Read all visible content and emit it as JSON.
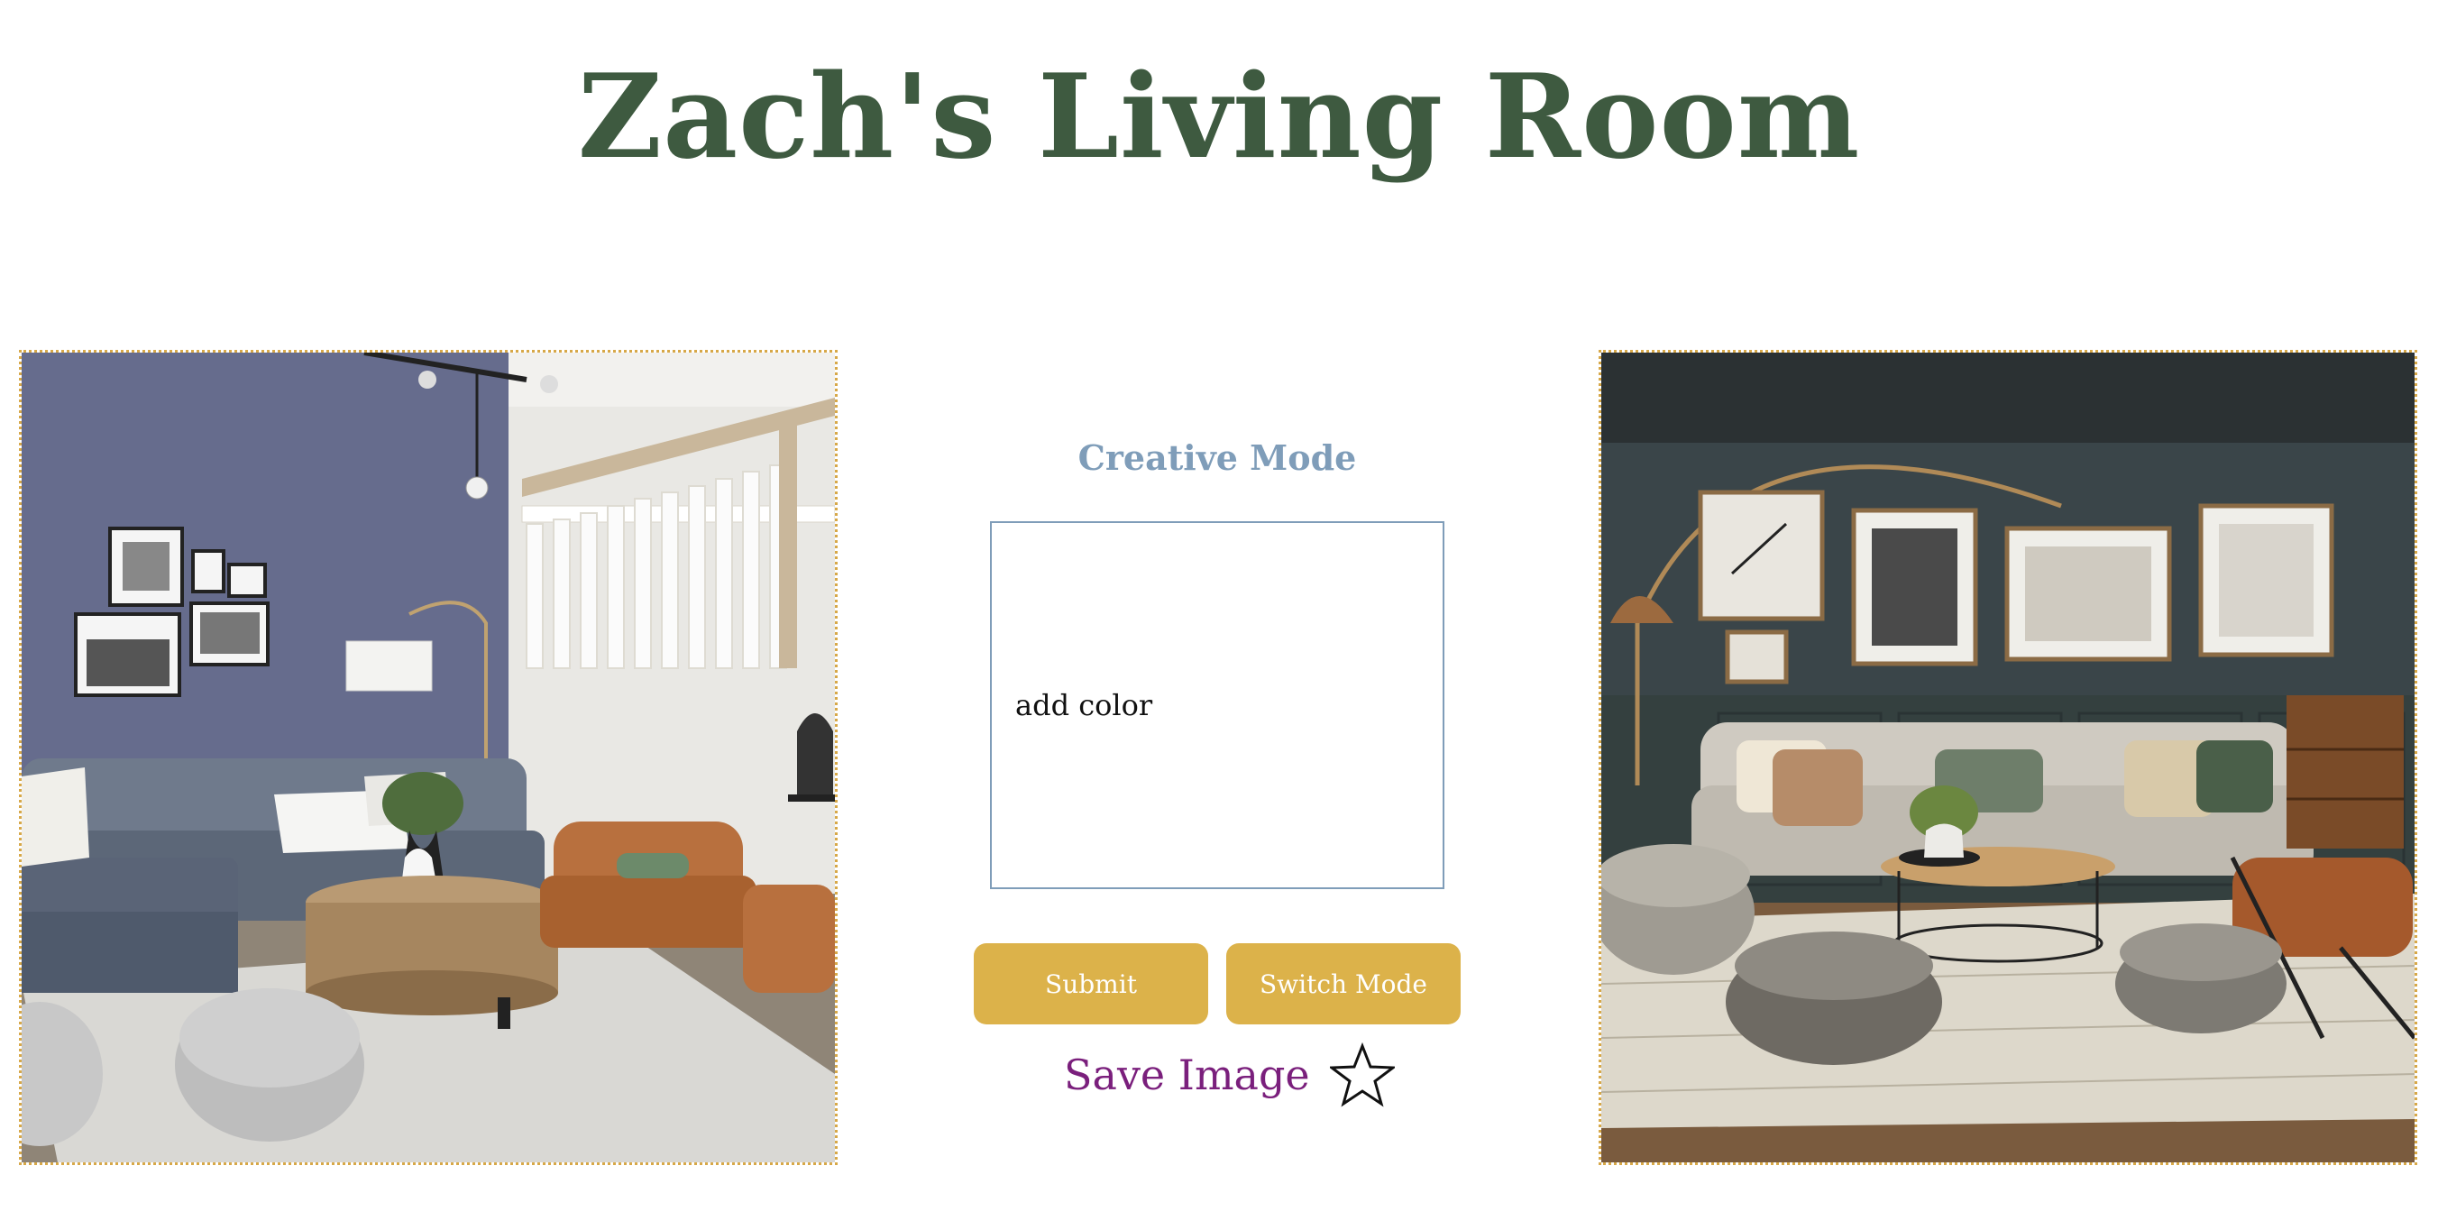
{
  "header": {
    "title": "Zach's Living Room"
  },
  "images": {
    "original": {
      "name": "original-room-photo"
    },
    "generated": {
      "name": "generated-room-photo"
    }
  },
  "controls": {
    "mode_label": "Creative Mode",
    "prompt_value": "add color",
    "submit_label": "Submit",
    "switch_label": "Switch Mode",
    "save_label": "Save Image",
    "save_icon": "star-outline-icon"
  },
  "colors": {
    "title": "#3e5a40",
    "mode_label": "#7f9db9",
    "button_bg": "#dcb24a",
    "button_text": "#ffffff",
    "save_text": "#7a1f7c",
    "frame_border": "#d7a848"
  }
}
